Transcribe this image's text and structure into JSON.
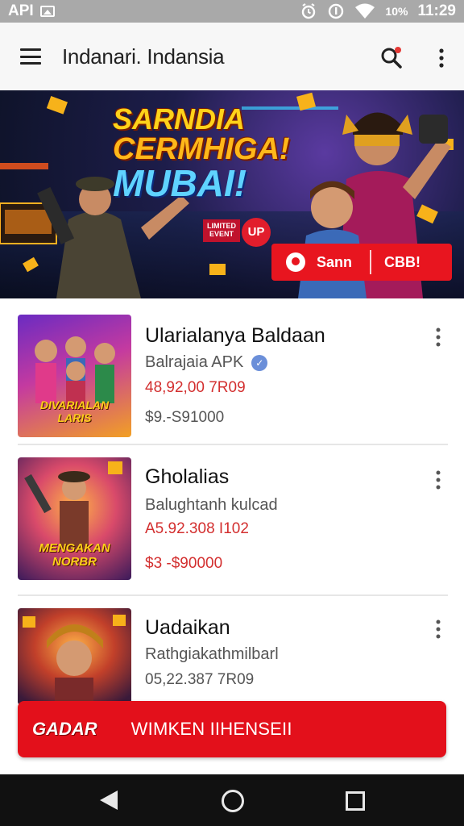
{
  "status_bar": {
    "carrier": "API",
    "battery": "10%",
    "time": "11:29"
  },
  "app_bar": {
    "title": "Indanari. Indansia",
    "icons": [
      "menu-icon",
      "search-icon",
      "more-vert-icon"
    ],
    "notification_dot_color": "#e53935"
  },
  "banner": {
    "headline_line1": "SARNDIA",
    "headline_line2": "CERMHIGA!",
    "headline_line3": "MUBAI!",
    "small_badge": "LIMITED EVENT",
    "circle_badge": "UP",
    "cta_primary": "Sann",
    "cta_secondary": "CBB!"
  },
  "items": [
    {
      "title": "Ularialanya Baldaan",
      "subtitle": "Balrajaia APK",
      "verified": true,
      "price_line1": "48,92,00 7R09",
      "price_line2": "$9.-S91000",
      "thumb_label": "DIVARIALAN LARIS"
    },
    {
      "title": "Gholalias",
      "subtitle": "Balughtanh kulcad",
      "verified": false,
      "price_line1": "A5.92.308 I102",
      "price_line2": "$3 -$90000",
      "thumb_label": "MENGAKAN NORBR"
    },
    {
      "title": "Uadaikan",
      "subtitle": "Rathgiakathmilbarl",
      "verified": false,
      "price_line1": "05,22.387 7R09",
      "price_line2": "",
      "thumb_label": ""
    }
  ],
  "promo_bar": {
    "logo": "GADAR",
    "text": "WIMKEN IIHENSEII"
  },
  "colors": {
    "accent_red": "#e3101b",
    "price_red": "#d32f2f",
    "price_dark": "#555555"
  }
}
